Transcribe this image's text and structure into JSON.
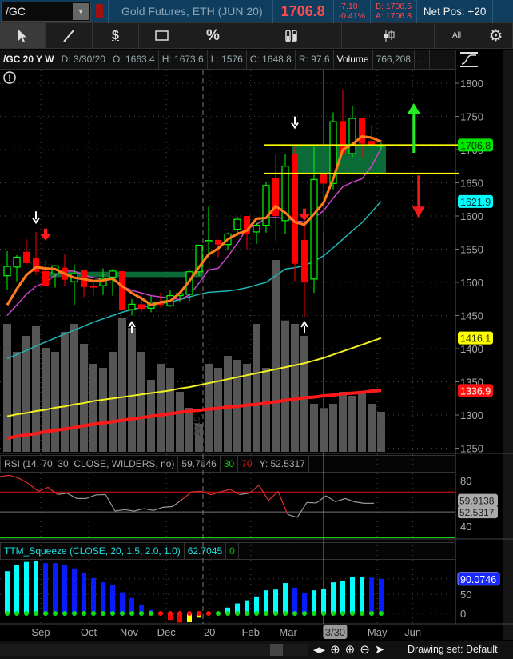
{
  "topbar": {
    "symbol": "/GC",
    "description": "Gold Futures, ETH (JUN 20)",
    "last": "1706.8",
    "change": "-7.10",
    "change_pct": "-0.41%",
    "bid": "B: 1706.5",
    "ask": "A: 1706.8",
    "net_pos": "Net Pos: +20"
  },
  "toolbar": {
    "all_label": "All",
    "percent_label": "%",
    "dollar_label": "$"
  },
  "infobar": {
    "title": "/GC 20 Y W",
    "date": "D: 3/30/20",
    "open": "O: 1663.4",
    "high": "H: 1673.6",
    "low": "L: 1576",
    "close": "C: 1648.8",
    "range": "R: 97.6",
    "volume_label": "Volume",
    "volume": "766,208",
    "more": "..."
  },
  "colors": {
    "up": "#00ff00",
    "down": "#ff0000",
    "ema": "#ff7a1a",
    "ma_magenta": "#cc44cc",
    "ma_cyan": "#1fb5b5",
    "ma_yellow": "#f0f020",
    "ma_red": "#ff1a1a",
    "sq_cyan": "#00ffff",
    "sq_blue": "#0a1aff",
    "sq_red": "#ff0000",
    "sq_yellow": "#ffff00"
  },
  "price_badges": [
    {
      "label": "1706.8",
      "bg": "#00e600",
      "fg": "#003300",
      "value": 1706.8
    },
    {
      "label": "1621.9",
      "bg": "#00ffff",
      "fg": "#003333",
      "value": 1621.9
    },
    {
      "label": "1416.1",
      "bg": "#ffff00",
      "fg": "#333300",
      "value": 1416.1
    },
    {
      "label": "1336.9",
      "bg": "#ff1010",
      "fg": "#ffffff",
      "value": 1336.9
    }
  ],
  "watermark": "2019",
  "chart_data": {
    "type": "candlestick",
    "title": "/GC 20 Y W",
    "yticks": [
      1800,
      1750,
      1700,
      1650,
      1600,
      1550,
      1500,
      1450,
      1400,
      1350,
      1300,
      1250
    ],
    "ylim": [
      1243,
      1822
    ],
    "xlabels": [
      {
        "label": "Sep",
        "i": 3.5
      },
      {
        "label": "Oct",
        "i": 8.5
      },
      {
        "label": "Nov",
        "i": 12.7
      },
      {
        "label": "Dec",
        "i": 16.6
      },
      {
        "label": "20",
        "i": 21.1
      },
      {
        "label": "Feb",
        "i": 25.4
      },
      {
        "label": "Mar",
        "i": 29.3
      },
      {
        "label": "3/30",
        "i": 34.2,
        "highlight": true
      },
      {
        "label": "May",
        "i": 38.6
      },
      {
        "label": "Jun",
        "i": 42.3
      }
    ],
    "candles": [
      [
        1510,
        1547,
        1489,
        1524
      ],
      [
        1523,
        1541,
        1502,
        1538
      ],
      [
        1546,
        1565,
        1527,
        1529
      ],
      [
        1536,
        1576,
        1511,
        1516
      ],
      [
        1517,
        1533,
        1494,
        1495
      ],
      [
        1513,
        1525,
        1492,
        1525
      ],
      [
        1522,
        1542,
        1494,
        1504
      ],
      [
        1501,
        1527,
        1466,
        1513
      ],
      [
        1519,
        1519,
        1478,
        1493
      ],
      [
        1494,
        1502,
        1480,
        1492
      ],
      [
        1495,
        1521,
        1481,
        1506
      ],
      [
        1508,
        1520,
        1480,
        1517
      ],
      [
        1517,
        1517,
        1458,
        1459
      ],
      [
        1459,
        1475,
        1450,
        1467
      ],
      [
        1467,
        1482,
        1455,
        1460
      ],
      [
        1461,
        1479,
        1455,
        1470
      ],
      [
        1471,
        1485,
        1462,
        1466
      ],
      [
        1465,
        1489,
        1463,
        1480
      ],
      [
        1480,
        1484,
        1470,
        1483
      ],
      [
        1482,
        1520,
        1472,
        1516
      ],
      [
        1516,
        1556,
        1510,
        1556
      ],
      [
        1561,
        1614,
        1541,
        1563
      ],
      [
        1564,
        1564,
        1538,
        1557
      ],
      [
        1557,
        1575,
        1548,
        1573
      ],
      [
        1580,
        1599,
        1570,
        1595
      ],
      [
        1600,
        1600,
        1549,
        1573
      ],
      [
        1576,
        1590,
        1558,
        1586
      ],
      [
        1586,
        1652,
        1575,
        1646
      ],
      [
        1657,
        1692,
        1563,
        1600
      ],
      [
        1593,
        1693,
        1573,
        1675
      ],
      [
        1694,
        1704,
        1502,
        1528
      ],
      [
        1564,
        1590,
        1448,
        1500
      ],
      [
        1505,
        1704,
        1484,
        1655
      ],
      [
        1663.4,
        1673.6,
        1576,
        1648.8
      ],
      [
        1649,
        1756,
        1640,
        1742
      ],
      [
        1743,
        1790,
        1691,
        1695
      ],
      [
        1694,
        1766,
        1689,
        1747
      ],
      [
        1747,
        1747,
        1689,
        1709
      ],
      [
        1713,
        1737,
        1680,
        1707
      ],
      [
        1705,
        1710,
        1700,
        1707
      ]
    ],
    "volume_k": [
      2240,
      1750,
      2030,
      2210,
      1820,
      1750,
      2100,
      2240,
      1890,
      1540,
      1470,
      1750,
      2350,
      2170,
      1750,
      1260,
      1540,
      1470,
      1050,
      770,
      490,
      1540,
      1470,
      1680,
      1610,
      1540,
      2240,
      1470,
      3360,
      2300,
      2240,
      2030,
      840,
      766,
      840,
      1050,
      980,
      1050,
      840,
      700
    ],
    "series": [
      {
        "name": "EMA",
        "color_key": "ema",
        "values": [
          1466,
          1490,
          1511,
          1523,
          1521,
          1520,
          1513,
          1507,
          1505,
          1502,
          1503,
          1506,
          1494,
          1484,
          1476,
          1466,
          1470,
          1472,
          1484,
          1502,
          1523,
          1542,
          1551,
          1565,
          1573,
          1578,
          1596,
          1597,
          1615,
          1605,
          1591,
          1587,
          1603,
          1620,
          1656,
          1700,
          1708,
          1720,
          1718,
          1712
        ]
      },
      {
        "name": "MA magenta",
        "color_key": "ma_magenta",
        "values": [
          1450,
          1466,
          1482,
          1494,
          1500,
          1511,
          1517,
          1517,
          1511,
          1507,
          1505,
          1504,
          1494,
          1488,
          1484,
          1480,
          1478,
          1476,
          1474,
          1481,
          1499,
          1519,
          1521,
          1539,
          1559,
          1581,
          1587,
          1597,
          1598,
          1596,
          1593,
          1591,
          1597,
          1608,
          1627,
          1644,
          1651,
          1656,
          1675,
          1702
        ]
      },
      {
        "name": "MA cyan",
        "color_key": "ma_cyan",
        "values": [
          1385,
          1391,
          1397,
          1404,
          1410,
          1416,
          1422,
          1428,
          1434,
          1440,
          1445,
          1450,
          1455,
          1459,
          1462,
          1465,
          1468,
          1470,
          1474,
          1478,
          1482,
          1485,
          1486,
          1487,
          1489,
          1492,
          1496,
          1500,
          1510,
          1520,
          1522,
          1525,
          1532,
          1540,
          1552,
          1565,
          1578,
          1590,
          1606,
          1622
        ]
      },
      {
        "name": "MA yellow",
        "color_key": "ma_yellow",
        "values": [
          1298,
          1301,
          1303,
          1306,
          1308,
          1311,
          1313,
          1316,
          1318,
          1321,
          1323,
          1325,
          1327,
          1329,
          1331,
          1333,
          1335,
          1337,
          1340,
          1342,
          1345,
          1348,
          1351,
          1354,
          1357,
          1360,
          1363,
          1366,
          1369,
          1372,
          1375,
          1378,
          1382,
          1386,
          1391,
          1396,
          1401,
          1406,
          1411,
          1416
        ]
      },
      {
        "name": "MA red",
        "color_key": "ma_red",
        "values": [
          1265,
          1268,
          1270,
          1272,
          1275,
          1277,
          1279,
          1281,
          1284,
          1286,
          1288,
          1290,
          1292,
          1294,
          1296,
          1298,
          1300,
          1302,
          1304,
          1306,
          1307,
          1309,
          1310,
          1312,
          1313,
          1315,
          1316,
          1318,
          1320,
          1322,
          1324,
          1326,
          1327,
          1329,
          1330,
          1332,
          1333,
          1334,
          1336,
          1337
        ]
      }
    ],
    "levels": [
      {
        "price": 1706.8,
        "from_i": 26.8
      },
      {
        "price": 1664,
        "from_i": 26.8
      }
    ],
    "zones": [
      {
        "from_i": 29.7,
        "to_i": 39.5,
        "top": 1706.8,
        "bottom": 1664
      },
      {
        "from_i": 4,
        "to_i": 20.4,
        "top": 1516,
        "bottom": 1508
      }
    ],
    "signals": [
      {
        "type": "white-down",
        "i": 3,
        "price": 1590
      },
      {
        "type": "red-down",
        "i": 4,
        "price": 1563
      },
      {
        "type": "white-up",
        "i": 13,
        "price": 1440
      },
      {
        "type": "white-down",
        "i": 30,
        "price": 1733
      },
      {
        "type": "red-down",
        "i": 31,
        "price": 1593
      },
      {
        "type": "white-up",
        "i": 31,
        "price": 1440
      },
      {
        "type": "green-up-arrow",
        "i": 42.4,
        "price": 1700
      },
      {
        "type": "red-down-arrow",
        "i": 42.9,
        "price": 1660
      }
    ],
    "rsi": {
      "header": "RSI (14, 70, 30, CLOSE, WILDERS, no)",
      "value": "59.7046",
      "ob_label": "30",
      "os_label": "70",
      "y_label": "Y: 52.5317",
      "yticks": [
        80,
        40
      ],
      "overbought": 70,
      "oversold": 30,
      "badges": [
        "59.9138",
        "52.5317"
      ],
      "values": [
        83.5,
        84.7,
        81.9,
        77.2,
        70.6,
        74.1,
        67.8,
        69,
        64.3,
        64.3,
        67.4,
        67.8,
        53.3,
        54.5,
        53.3,
        55.4,
        53.8,
        56.6,
        57.3,
        63.5,
        70.2,
        70.6,
        67.6,
        70.2,
        72.3,
        67.8,
        69,
        76,
        62.5,
        70.6,
        50.3,
        47.7,
        60.8,
        60.4,
        66.7,
        61.5,
        64.3,
        61.3,
        60.1,
        60.1
      ]
    },
    "squeeze": {
      "header": "TTM_Squeeze (CLOSE, 20, 1.5, 2.0, 1.0)",
      "value": "62.7045",
      "zero_label": "0",
      "yticks": [
        50,
        0
      ],
      "badge": "90.0746",
      "values": [
        110,
        126,
        134,
        136,
        131,
        131,
        126,
        117,
        105,
        92,
        81,
        73,
        55,
        40,
        23,
        9,
        -3,
        -17,
        -24,
        -23,
        -11,
        -3,
        1,
        15,
        26,
        34,
        44,
        60,
        62,
        79,
        67,
        52,
        60,
        64,
        81,
        85,
        96,
        96,
        93,
        90.07
      ],
      "colors": [
        "c",
        "c",
        "c",
        "c",
        "b",
        "b",
        "b",
        "b",
        "b",
        "b",
        "b",
        "b",
        "b",
        "b",
        "b",
        "b",
        "r",
        "r",
        "r",
        "y",
        "y",
        "r",
        "c",
        "c",
        "c",
        "c",
        "c",
        "c",
        "c",
        "c",
        "b",
        "b",
        "c",
        "c",
        "c",
        "c",
        "c",
        "c",
        "b",
        "b"
      ],
      "dots": [
        "g",
        "g",
        "g",
        "g",
        "g",
        "g",
        "g",
        "g",
        "g",
        "g",
        "g",
        "g",
        "g",
        "g",
        "g",
        "g",
        "r",
        "r",
        "r",
        "r",
        "r",
        "r",
        "g",
        "g",
        "g",
        "g",
        "g",
        "g",
        "g",
        "g",
        "g",
        "g",
        "g",
        "g",
        "g",
        "g",
        "g",
        "g",
        "g",
        "g"
      ]
    }
  },
  "bottom": {
    "drawing_set": "Drawing set: Default"
  }
}
